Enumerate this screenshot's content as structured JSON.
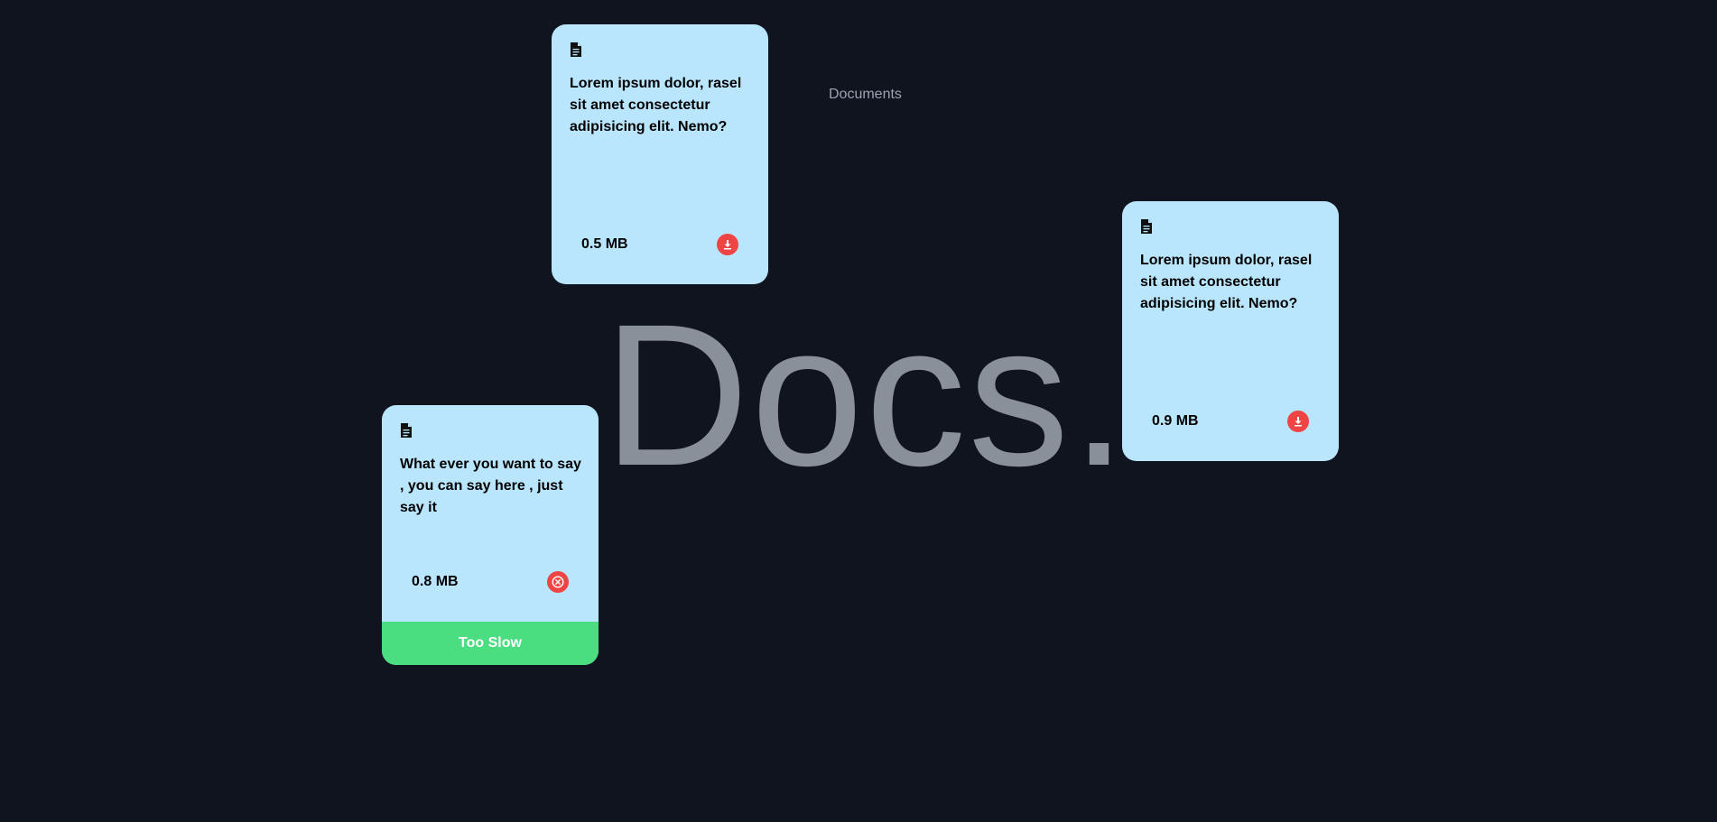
{
  "header": {
    "title": "Documents"
  },
  "watermark": {
    "text": "Docs."
  },
  "cards": [
    {
      "description": "Lorem ipsum dolor, rasel sit amet consectetur adipisicing elit. Nemo?",
      "size": "0.5 MB",
      "action_icon": "download-icon"
    },
    {
      "description": "Lorem ipsum dolor, rasel sit amet consectetur adipisicing elit. Nemo?",
      "size": "0.9 MB",
      "action_icon": "download-icon"
    },
    {
      "description": "What ever you want to say , you can say here , just say it",
      "size": "0.8 MB",
      "action_icon": "close-circle-icon",
      "footer_label": "Too Slow"
    }
  ],
  "colors": {
    "background": "#0f141e",
    "card": "#bae6fd",
    "action_button": "#ef4444",
    "footer": "#4ade80"
  }
}
